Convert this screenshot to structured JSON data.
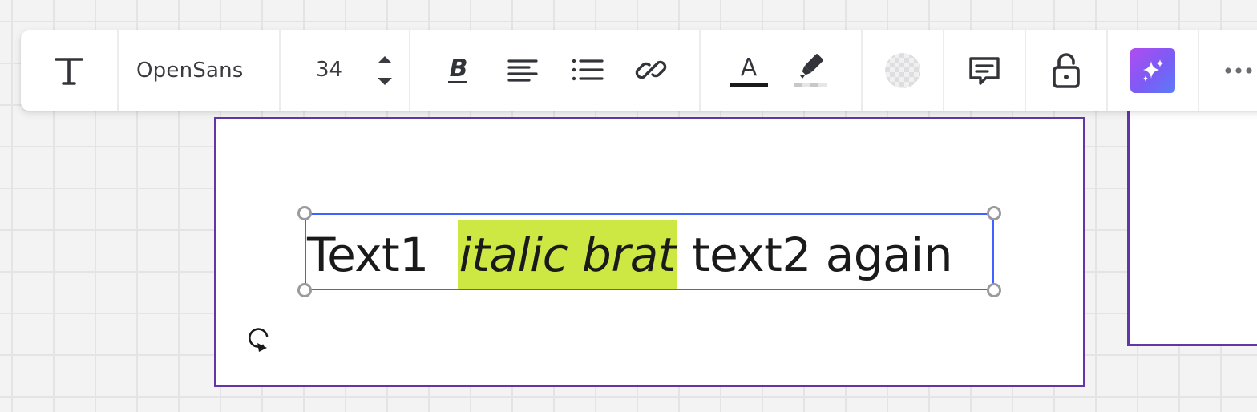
{
  "toolbar": {
    "text_tool_icon": "text-T-icon",
    "font_family": "OpenSans",
    "font_size": "34",
    "buttons": {
      "bold": "bold-icon",
      "align": "align-left-icon",
      "list": "bulleted-list-icon",
      "link": "link-icon",
      "text_color": "text-color-icon",
      "highlight": "highlighter-icon",
      "fill": "transparent-fill-swatch",
      "comment": "comment-icon",
      "lock": "unlock-icon",
      "ai": "sparkles-icon",
      "more": "more-icon"
    },
    "colors": {
      "text_color_bar": "#1a1a1a",
      "highlight_bar": "#d8d8d8",
      "ai_gradient_start": "#b04cf0",
      "ai_gradient_end": "#5b7cf7"
    }
  },
  "canvas": {
    "frame_border_color": "#6236a6",
    "text_segments": {
      "plain_start": "Text1  ",
      "highlighted": "italic brat",
      "plain_end": " text2 again"
    },
    "highlight_color": "#cde843",
    "selection_color": "#4262ff"
  }
}
